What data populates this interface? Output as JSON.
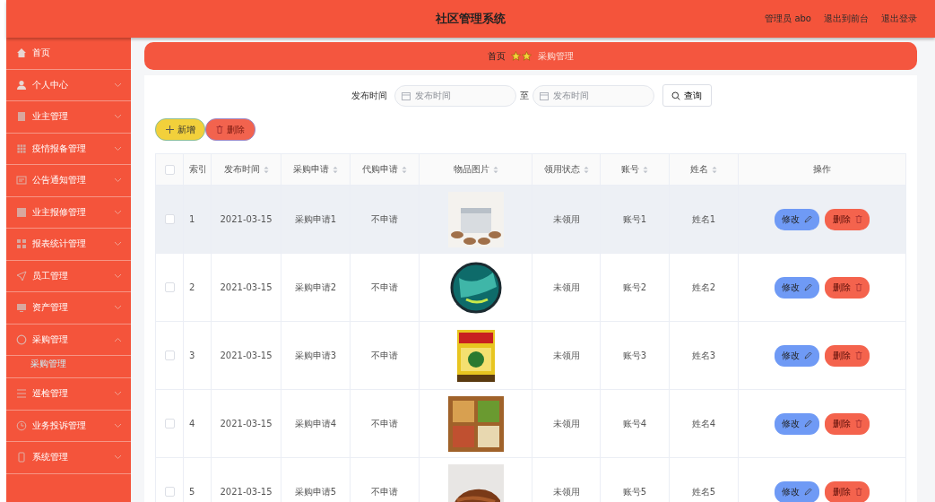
{
  "header": {
    "title": "社区管理系统",
    "links": [
      "管理员 abo",
      "退出到前台",
      "退出登录"
    ]
  },
  "sidebar": {
    "items": [
      {
        "label": "首页"
      },
      {
        "label": "个人中心",
        "expanded": false
      },
      {
        "label": "业主管理",
        "expanded": false
      },
      {
        "label": "疫情报备管理",
        "expanded": false
      },
      {
        "label": "公告通知管理",
        "expanded": false
      },
      {
        "label": "业主报修管理",
        "expanded": false
      },
      {
        "label": "报表统计管理",
        "expanded": false
      },
      {
        "label": "员工管理",
        "expanded": false
      },
      {
        "label": "资产管理",
        "expanded": false
      },
      {
        "label": "采购管理",
        "expanded": true,
        "children": [
          {
            "label": "采购管理",
            "selected": true
          }
        ]
      },
      {
        "label": "巡检管理",
        "expanded": false
      },
      {
        "label": "业务投诉管理",
        "expanded": false
      },
      {
        "label": "系统管理",
        "expanded": false
      }
    ]
  },
  "breadcrumb": [
    "首页",
    "采购管理"
  ],
  "search": {
    "label": "发布时间",
    "from_placeholder": "发布时间",
    "separator": "至",
    "to_placeholder": "发布时间",
    "button": "查询"
  },
  "actions": [
    "新增",
    "删除"
  ],
  "table": {
    "select_all_checked": false,
    "columns": [
      {
        "label": "索引",
        "sortable": false
      },
      {
        "label": "发布时间",
        "sortable": true
      },
      {
        "label": "采购申请",
        "sortable": true
      },
      {
        "label": "代购申请",
        "sortable": true
      },
      {
        "label": "物品图片",
        "sortable": true
      },
      {
        "label": "领用状态",
        "sortable": true
      },
      {
        "label": "账号",
        "sortable": true
      },
      {
        "label": "姓名",
        "sortable": true
      },
      {
        "label": "操作",
        "sortable": false
      }
    ],
    "rows": [
      {
        "index": "1",
        "date": "2021-03-15",
        "purchase": "采购申请1",
        "proxy": "不申请",
        "picture": {
          "kind": "picture"
        },
        "status": "未领用",
        "account": "账号1",
        "name": "姓名1",
        "highlighted": true,
        "checked": false,
        "actions": [
          "修改",
          "删除"
        ]
      },
      {
        "index": "2",
        "date": "2021-03-15",
        "purchase": "采购申请2",
        "proxy": "不申请",
        "picture": {
          "kind": "picture"
        },
        "status": "未领用",
        "account": "账号2",
        "name": "姓名2",
        "highlighted": false,
        "checked": false,
        "actions": [
          "修改",
          "删除"
        ]
      },
      {
        "index": "3",
        "date": "2021-03-15",
        "purchase": "采购申请3",
        "proxy": "不申请",
        "picture": {
          "kind": "picture"
        },
        "status": "未领用",
        "account": "账号3",
        "name": "姓名3",
        "highlighted": false,
        "checked": false,
        "actions": [
          "修改",
          "删除"
        ]
      },
      {
        "index": "4",
        "date": "2021-03-15",
        "purchase": "采购申请4",
        "proxy": "不申请",
        "picture": {
          "kind": "picture"
        },
        "status": "未领用",
        "account": "账号4",
        "name": "姓名4",
        "highlighted": false,
        "checked": false,
        "actions": [
          "修改",
          "删除"
        ]
      },
      {
        "index": "5",
        "date": "2021-03-15",
        "purchase": "采购申请5",
        "proxy": "不申请",
        "picture": {
          "kind": "picture"
        },
        "status": "未领用",
        "account": "账号5",
        "name": "姓名5",
        "highlighted": false,
        "checked": false,
        "actions": [
          "修改",
          "删除"
        ]
      }
    ]
  }
}
